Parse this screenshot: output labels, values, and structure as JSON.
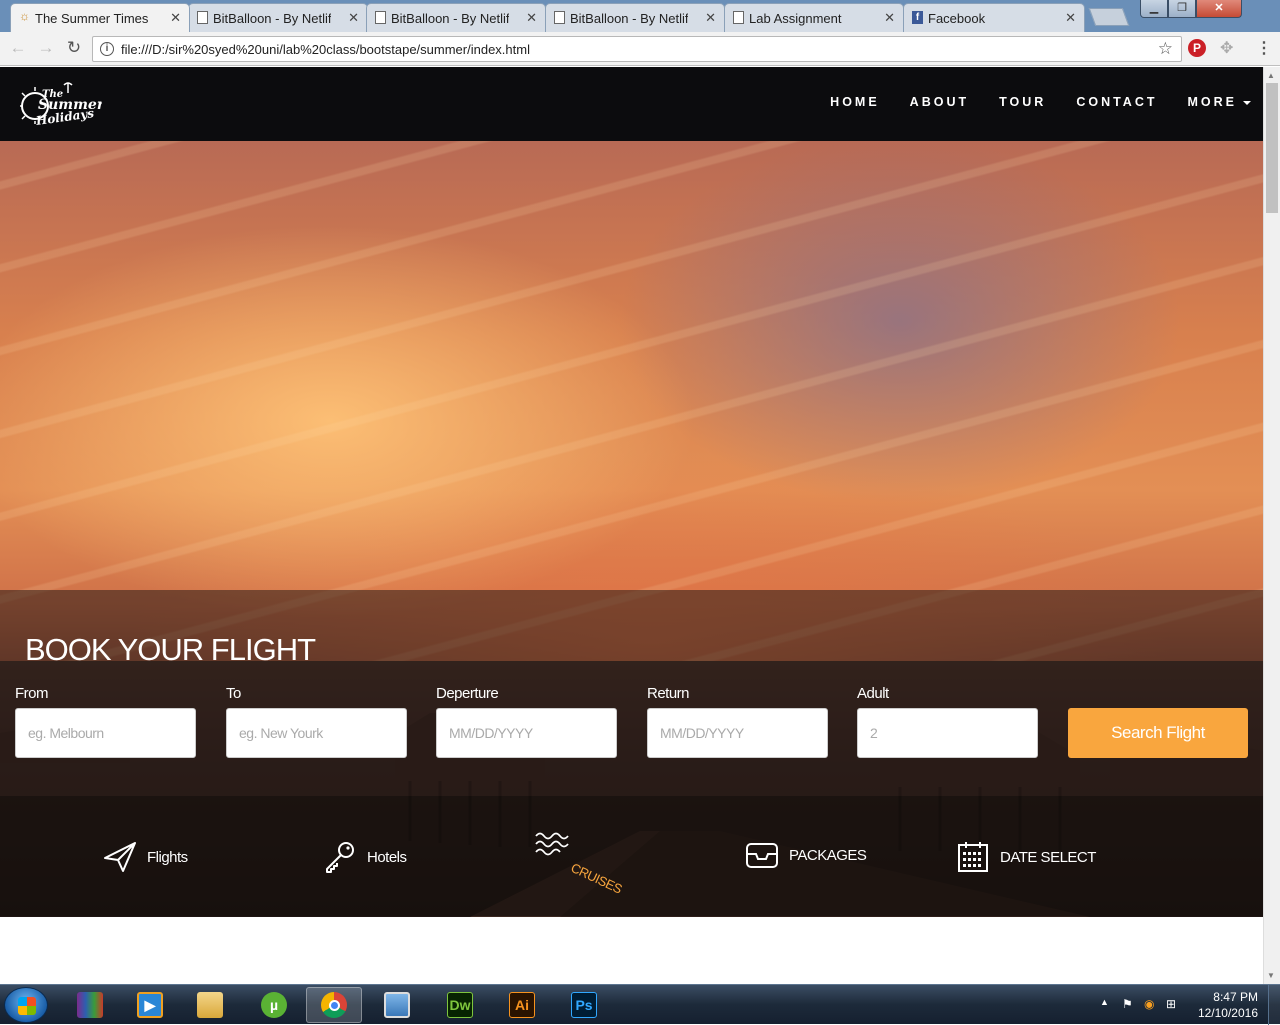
{
  "browser": {
    "tabs": [
      {
        "title": "The Summer Times Ho",
        "icon": "sun-logo-icon",
        "active": true
      },
      {
        "title": "BitBalloon - By Netlify",
        "icon": "page-icon"
      },
      {
        "title": "BitBalloon - By Netlify",
        "icon": "page-icon"
      },
      {
        "title": "BitBalloon - By Netlify",
        "icon": "page-icon"
      },
      {
        "title": "Lab Assignment",
        "icon": "page-icon"
      },
      {
        "title": "Facebook",
        "icon": "facebook-icon"
      }
    ],
    "url": "file:///D:/sir%20syed%20uni/lab%20class/bootstape/summer/index.html"
  },
  "site": {
    "logo_text": [
      "The",
      "Summer",
      "Holidays"
    ],
    "nav": {
      "home": "HOME",
      "about": "ABOUT",
      "tour": "TOUR",
      "contact": "CONTACT",
      "more": "MORE"
    },
    "booking": {
      "title": "BOOK YOUR FLIGHT",
      "from_label": "From",
      "from_placeholder": "eg. Melbourn",
      "to_label": "To",
      "to_placeholder": "eg. New Yourk",
      "departure_label": "Deperture",
      "departure_placeholder": "MM/DD/YYYY",
      "return_label": "Return",
      "return_placeholder": "MM/DD/YYYY",
      "adult_label": "Adult",
      "adult_placeholder": "2",
      "search_button": "Search Flight"
    },
    "services": {
      "flights": "Flights",
      "hotels": "Hotels",
      "cruises": "CRUISES",
      "packages": "PACKAGES",
      "date_select": "DATE SELECT"
    },
    "colors": {
      "accent": "#f9a63e",
      "nav_bg": "#0c0c0e"
    }
  },
  "taskbar": {
    "apps": [
      "winrar-icon",
      "media-player-icon",
      "explorer-icon",
      "utorrent-icon",
      "chrome-icon",
      "photo-viewer-icon",
      "Dw",
      "Ai",
      "Ps"
    ],
    "time": "8:47 PM",
    "date": "12/10/2016"
  }
}
